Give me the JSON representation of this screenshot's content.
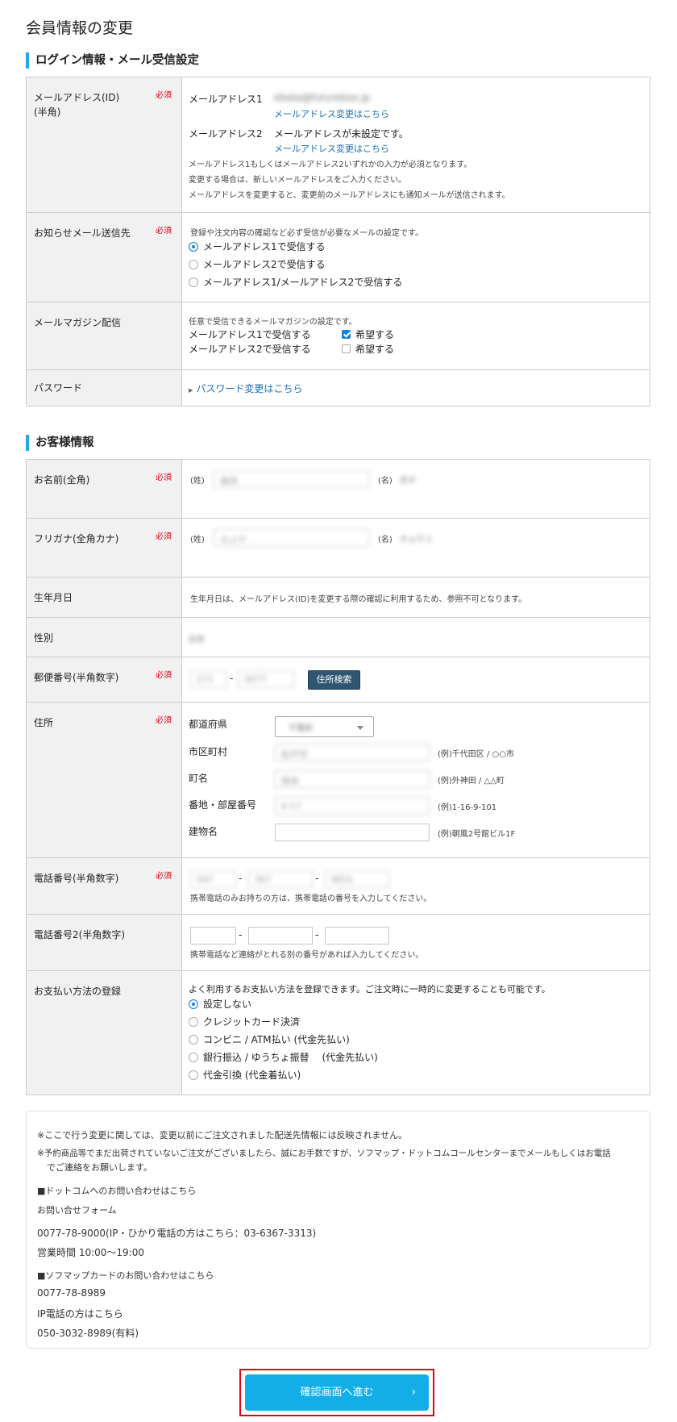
{
  "page_title": "会員情報の変更",
  "required_label": "必須",
  "login_section": {
    "title": "ログイン情報・メール受信設定",
    "email": {
      "label": "メールアドレス(ID)",
      "label_sub": "(半角)",
      "addr1_label": "メールアドレス1",
      "addr1_value": "ebata@futurebox.jp",
      "change_link": "メールアドレス変更はこちら",
      "addr2_label": "メールアドレス2",
      "addr2_value": "メールアドレスが未設定です。",
      "note1": "メールアドレス1もしくはメールアドレス2いずれかの入力が必須となります。",
      "note2": "変更する場合は、新しいメールアドレスをご入力ください。",
      "note3": "メールアドレスを変更すると、変更前のメールアドレスにも通知メールが送信されます。"
    },
    "notify": {
      "label": "お知らせメール送信先",
      "note": "登録や注文内容の確認など必ず受信が必要なメールの設定です。",
      "options": [
        "メールアドレス1で受信する",
        "メールアドレス2で受信する",
        "メールアドレス1/メールアドレス2で受信する"
      ]
    },
    "magazine": {
      "label": "メールマガジン配信",
      "note": "任意で受信できるメールマガジンの設定です。",
      "rows": [
        {
          "label": "メールアドレス1で受信する",
          "check": "希望する"
        },
        {
          "label": "メールアドレス2で受信する",
          "check": "希望する"
        }
      ]
    },
    "password": {
      "label": "パスワード",
      "link": "パスワード変更はこちら"
    }
  },
  "customer_section": {
    "title": "お客様情報",
    "name": {
      "label": "お名前(全角)",
      "sei": "(姓)",
      "mei": "(名)",
      "sei_value": "森林",
      "mei_value": "京子"
    },
    "kana": {
      "label": "フリガナ(全角カナ)",
      "sei": "(姓)",
      "mei": "(名)",
      "sei_value": "カメヤ",
      "mei_value": "キョウコ"
    },
    "birthday": {
      "label": "生年月日",
      "note": "生年月日は、メールアドレス(ID)を変更する際の確認に利用するため、参照不可となります。"
    },
    "gender": {
      "label": "性別",
      "value": "女性"
    },
    "zip": {
      "label": "郵便番号(半角数字)",
      "zip1": "271",
      "zip2": "0077",
      "button": "住所検索",
      "dash": "-"
    },
    "address": {
      "label": "住所",
      "pref_label": "都道府県",
      "pref_value": "千葉県",
      "city_label": "市区町村",
      "city_value": "松戸市",
      "city_example": "(例)千代田区 / ○○市",
      "town_label": "町名",
      "town_value": "根本",
      "town_example": "(例)外神田 / △△町",
      "num_label": "番地・部屋番号",
      "num_value": "6-17",
      "num_example": "(例)1-16-9-101",
      "bldg_label": "建物名",
      "bldg_example": "(例)朝風2号館ビル1F"
    },
    "phone": {
      "label": "電話番号(半角数字)",
      "p1": "047",
      "p2": "367",
      "p3": "8831",
      "note": "携帯電話のみお持ちの方は、携帯電話の番号を入力してください。"
    },
    "phone2": {
      "label": "電話番号2(半角数字)",
      "note": "携帯電話など連絡がとれる別の番号があれば入力してください。"
    },
    "payment": {
      "label": "お支払い方法の登録",
      "note": "よく利用するお支払い方法を登録できます。ご注文時に一時的に変更することも可能です。",
      "options": [
        "設定しない",
        "クレジットカード決済",
        "コンビニ / ATM払い (代金先払い)",
        "銀行振込 / ゆうちょ振替　 (代金先払い)",
        "代金引換 (代金着払い)"
      ]
    }
  },
  "notice": {
    "line1": "※ここで行う変更に関しては、変更以前にご注文されました配送先情報には反映されません。",
    "line2a": "※予約商品等でまだ出荷されていないご注文がございましたら、誠にお手数ですが、ソフマップ・ドットコムコールセンターまでメールもしくはお電話",
    "line2b": "でご連絡をお願いします。",
    "dotcom_heading": "■ドットコムへのお問い合わせはこちら",
    "form_link": "お問い合せフォーム",
    "phone_line": "0077-78-9000(IP・ひかり電話の方はこちら：03-6367-3313)",
    "hours": "営業時間 10:00〜19:00",
    "card_heading": "■ソフマップカードのお問い合わせはこちら",
    "card_phone": "0077-78-8989",
    "ip_label": "IP電話の方はこちら",
    "ip_phone": "050-3032-8989(有料)"
  },
  "cta": {
    "label": "確認画面へ進む",
    "chevron": "›"
  }
}
